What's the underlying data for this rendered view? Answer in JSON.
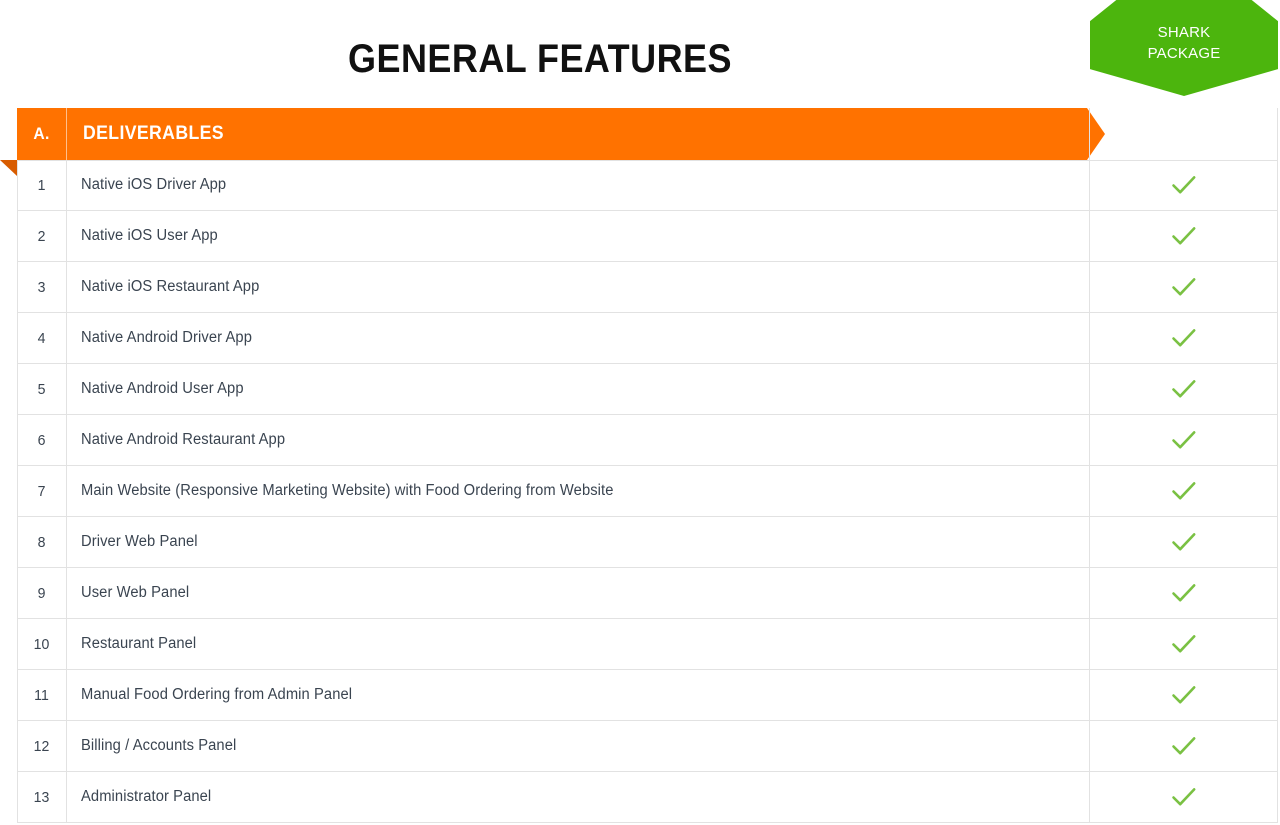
{
  "header": {
    "title": "GENERAL FEATURES"
  },
  "badge": {
    "label": "SHARK\nPACKAGE",
    "color": "#4CB50D",
    "text_color": "#ffffff"
  },
  "section": {
    "letter": "A.",
    "title": "DELIVERABLES",
    "color": "#FF7200",
    "fold_color": "#D85C00"
  },
  "columns": {
    "number": "",
    "deliverable": "DELIVERABLES",
    "package": "SHARK PACKAGE"
  },
  "check": {
    "icon": "check-icon",
    "color": "#7AC143"
  },
  "rows": [
    {
      "num": "1",
      "label": "Native iOS Driver App",
      "included": true
    },
    {
      "num": "2",
      "label": "Native iOS User App",
      "included": true
    },
    {
      "num": "3",
      "label": "Native iOS Restaurant App",
      "included": true
    },
    {
      "num": "4",
      "label": "Native Android Driver App",
      "included": true
    },
    {
      "num": "5",
      "label": "Native Android User App",
      "included": true
    },
    {
      "num": "6",
      "label": "Native Android Restaurant App",
      "included": true
    },
    {
      "num": "7",
      "label": "Main Website (Responsive Marketing Website) with Food Ordering from Website",
      "included": true
    },
    {
      "num": "8",
      "label": "Driver Web Panel",
      "included": true
    },
    {
      "num": "9",
      "label": "User Web Panel",
      "included": true
    },
    {
      "num": "10",
      "label": "Restaurant Panel",
      "included": true
    },
    {
      "num": "11",
      "label": "Manual Food Ordering from Admin Panel",
      "included": true
    },
    {
      "num": "12",
      "label": "Billing / Accounts Panel",
      "included": true
    },
    {
      "num": "13",
      "label": "Administrator Panel",
      "included": true
    }
  ]
}
